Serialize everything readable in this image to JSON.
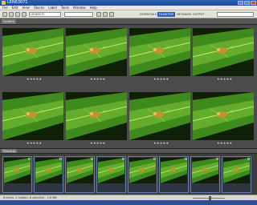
{
  "window": {
    "title": "LEN63071",
    "icon": "bridge-app-icon"
  },
  "menubar": {
    "items": [
      "File",
      "Edit",
      "View",
      "Stacks",
      "Label",
      "Tools",
      "Window",
      "Help"
    ]
  },
  "toolbar": {
    "path_field": "LEN63071",
    "workspaces": [
      "ESSENTIALS",
      "FILMSTRIP",
      "METADATA",
      "OUTPUT"
    ],
    "active_workspace": "FILMSTRIP",
    "search_placeholder": ""
  },
  "content_panel": {
    "tab_label": "Content"
  },
  "thumbnails": [
    {
      "rating": "★★★★★",
      "filename": ""
    },
    {
      "rating": "★★★★★",
      "filename": ""
    },
    {
      "rating": "★★★★★",
      "filename": ""
    },
    {
      "rating": "★★★★★",
      "filename": ""
    },
    {
      "rating": "★★★★★",
      "filename": ""
    },
    {
      "rating": "★★★★★",
      "filename": ""
    },
    {
      "rating": "★★★★★",
      "filename": ""
    },
    {
      "rating": "★★★★★",
      "filename": ""
    }
  ],
  "filmstrip": {
    "tab_label": "Filmstrip",
    "frames": [
      "",
      "",
      "",
      "",
      "",
      "",
      "",
      ""
    ]
  },
  "statusbar": {
    "text": "8 items, 1 hidden, 8 selected - 2.6 MB"
  },
  "colors": {
    "titlebar": "#2d5fb3",
    "panel_bg": "#4b4b4b",
    "leaf_green": "#3f8a1c",
    "selection_blue": "#5e7fb3"
  }
}
